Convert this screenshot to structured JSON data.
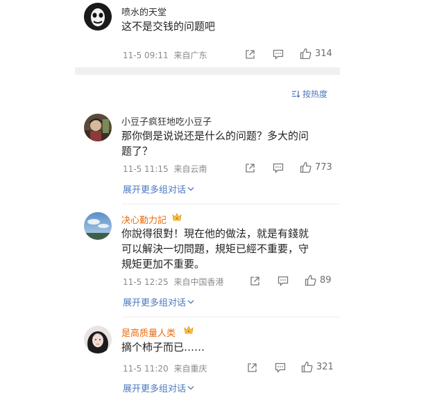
{
  "sort": {
    "label": "按热度"
  },
  "comments": [
    {
      "name": "喷水的天堂",
      "text": "这不是交钱的问题吧",
      "time": "11-5 09:11",
      "source": "来自广东",
      "likes": "314"
    },
    {
      "name": "小豆子疯狂地吃小豆子",
      "text": [
        "那你倒是说说还是什么的问题？多大的问",
        "题了？"
      ],
      "time": "11-5 11:15",
      "source": "来自云南",
      "likes": "773",
      "expand": "展开更多组对话"
    },
    {
      "name": "决心勤力記",
      "text": [
        "你說得很對！現在他的做法，就是有錢就",
        "可以解決一切問題，規矩已經不重要，守",
        "規矩更加不重要。"
      ],
      "time": "11-5 12:25",
      "source": "来自中国香港",
      "likes": "89",
      "expand": "展开更多组对话"
    },
    {
      "name": "是高质量人类",
      "text": "摘个柿子而已……",
      "time": "11-5 11:20",
      "source": "来自重庆",
      "likes": "321",
      "expand": "展开更多组对话"
    }
  ],
  "colors": {
    "link": "#4a79bd",
    "vip_name": "#e86b0c",
    "meta": "#8a8a8a"
  }
}
